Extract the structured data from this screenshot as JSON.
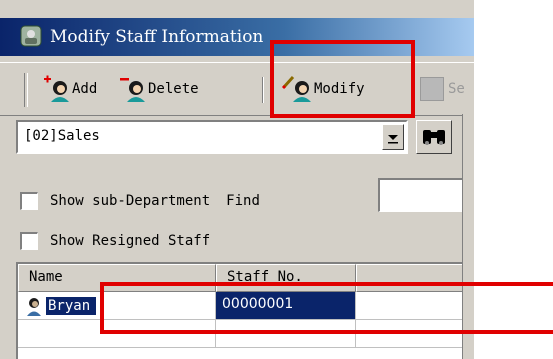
{
  "window": {
    "title": "Modify Staff Information"
  },
  "toolbar": {
    "add_label": "Add",
    "delete_label": "Delete",
    "modify_label": "Modify",
    "save_label": "Se"
  },
  "department": {
    "value": "[02]Sales"
  },
  "options": {
    "show_sub_department": {
      "label": "Show sub-Department",
      "checked": false
    },
    "show_resigned_staff": {
      "label": "Show Resigned Staff",
      "checked": false
    }
  },
  "find": {
    "label": "Find",
    "value": ""
  },
  "grid": {
    "columns": [
      "Name",
      "Staff No."
    ],
    "rows": [
      {
        "name": "Bryan",
        "staff_no": "00000001",
        "selected": true
      }
    ]
  },
  "colors": {
    "highlight": "#e00000",
    "selection": "#0a246a",
    "face": "#d4d0c8"
  },
  "icons": [
    "app-icon",
    "add-user-icon",
    "delete-user-icon",
    "modify-user-icon",
    "save-icon",
    "dropdown-arrow-icon",
    "binoculars-icon",
    "person-icon"
  ]
}
